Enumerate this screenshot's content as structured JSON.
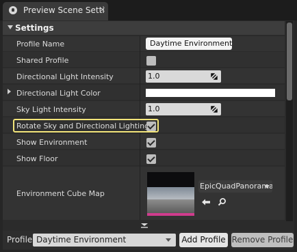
{
  "tab": {
    "title": "Preview Scene Setti",
    "close": "✕"
  },
  "section": {
    "title": "Settings"
  },
  "properties": {
    "profile_name": {
      "label": "Profile Name",
      "value": "Daytime Environment"
    },
    "shared_profile": {
      "label": "Shared Profile",
      "checked": false
    },
    "directional_light_intensity": {
      "label": "Directional Light Intensity",
      "value": "1.0"
    },
    "directional_light_color": {
      "label": "Directional Light Color",
      "color": "#ffffff"
    },
    "sky_light_intensity": {
      "label": "Sky Light Intensity",
      "value": "1.0"
    },
    "rotate_sky": {
      "label": "Rotate Sky and Directional Lighting",
      "checked": true
    },
    "show_environment": {
      "label": "Show Environment",
      "checked": true
    },
    "show_floor": {
      "label": "Show Floor",
      "checked": true
    },
    "environment_cube_map": {
      "label": "Environment Cube Map",
      "asset": "EpicQuadPanorama"
    }
  },
  "footer": {
    "profile_label": "Profile",
    "profile_selected": "Daytime Environment",
    "add_button": "Add Profile",
    "remove_button": "Remove Profile"
  },
  "colors": {
    "highlight": "#f3e57a",
    "asset_bar": "#d03c8e"
  }
}
